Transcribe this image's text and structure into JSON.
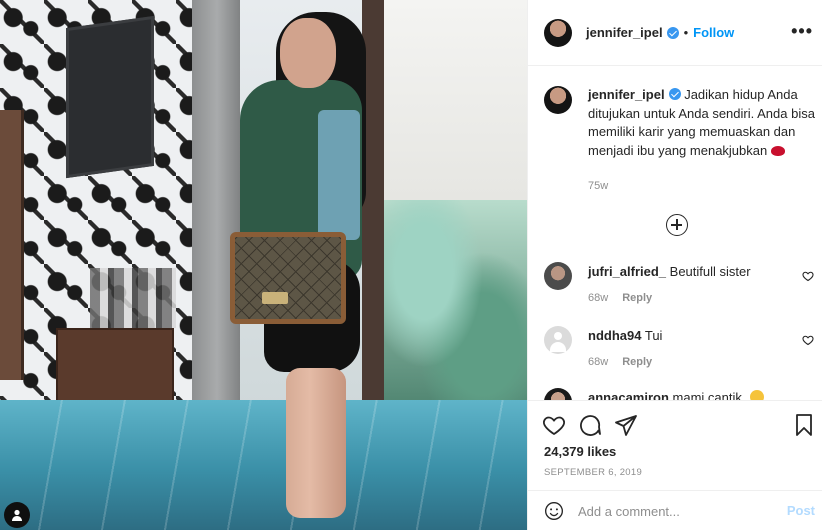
{
  "post": {
    "username": "jennifer_ipel",
    "follow_label": "Follow",
    "separator": "•",
    "more_label": "•••"
  },
  "caption": {
    "username": "jennifer_ipel",
    "text": "Jadikan hidup Anda ditujukan untuk Anda sendiri. Anda bisa memiliki karir yang memuaskan dan menjadi ibu yang menakjubkan",
    "time": "75w"
  },
  "comments": [
    {
      "username": "jufri_alfried_",
      "text": "Beutifull sister",
      "time": "68w",
      "reply_label": "Reply"
    },
    {
      "username": "nddha94",
      "text": "Tui",
      "time": "68w",
      "reply_label": "Reply"
    },
    {
      "username": "annacamiron",
      "text": "mami cantik"
    }
  ],
  "stats": {
    "likes": "24,379 likes",
    "date": "SEPTEMBER 6, 2019"
  },
  "add_comment": {
    "placeholder": "Add a comment...",
    "post_label": "Post"
  },
  "icons": [
    "verified-badge-icon",
    "load-more-icon",
    "heart-icon",
    "comment-icon",
    "share-icon",
    "bookmark-icon",
    "emoji-icon",
    "user-tag-icon"
  ],
  "colors": {
    "accent": "#0095f6",
    "verified": "#3897f0",
    "muted": "#8e8e8e",
    "post_disabled": "#b3dbff"
  }
}
